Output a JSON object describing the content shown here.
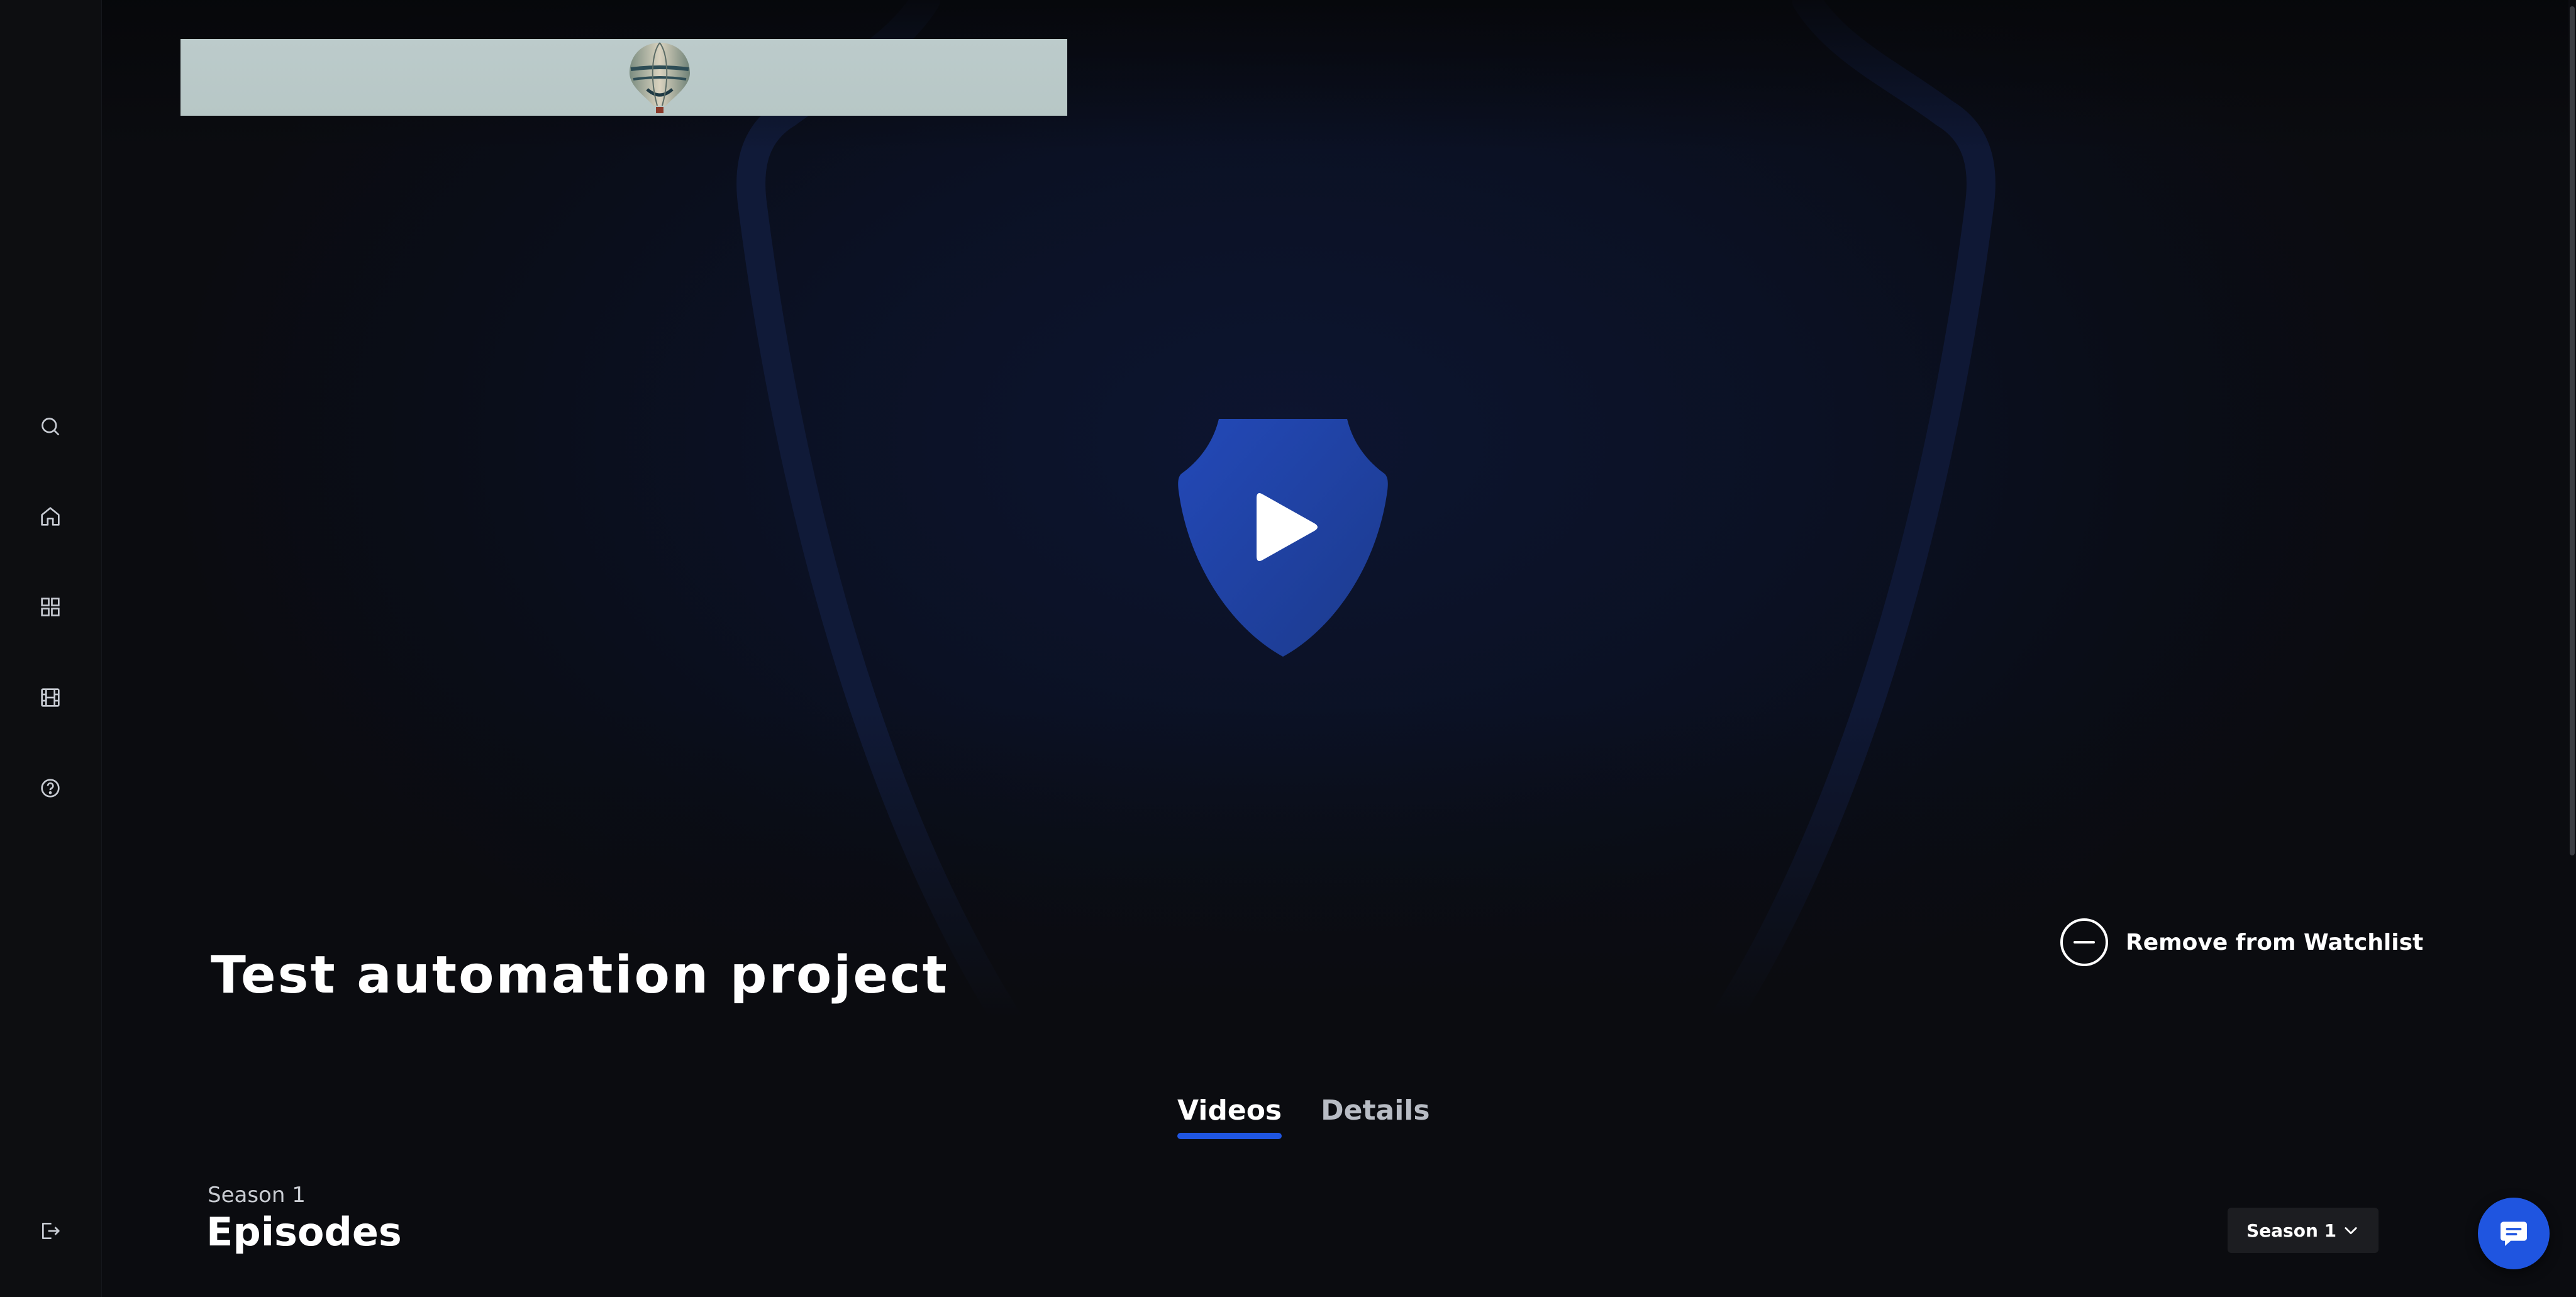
{
  "sidebar": {
    "items": [
      {
        "name": "search",
        "icon": "search-icon"
      },
      {
        "name": "home",
        "icon": "home-icon"
      },
      {
        "name": "categories",
        "icon": "grid-icon"
      },
      {
        "name": "videos",
        "icon": "film-icon"
      },
      {
        "name": "help",
        "icon": "help-icon"
      }
    ],
    "logout_icon": "logout-icon"
  },
  "hero": {
    "banner_image": "hot-air-balloon",
    "play_icon": "play-shield-icon",
    "title": "Test automation project",
    "watchlist_label": "Remove from Watchlist"
  },
  "tabs": [
    {
      "label": "Videos",
      "active": true
    },
    {
      "label": "Details",
      "active": false
    }
  ],
  "episodes": {
    "season_label": "Season 1",
    "heading": "Episodes",
    "season_select_value": "Season 1"
  },
  "chat": {
    "icon": "chat-icon"
  },
  "colors": {
    "accent": "#1f55e0",
    "background": "#0b0c10",
    "hero_blue": "#0d1530"
  }
}
